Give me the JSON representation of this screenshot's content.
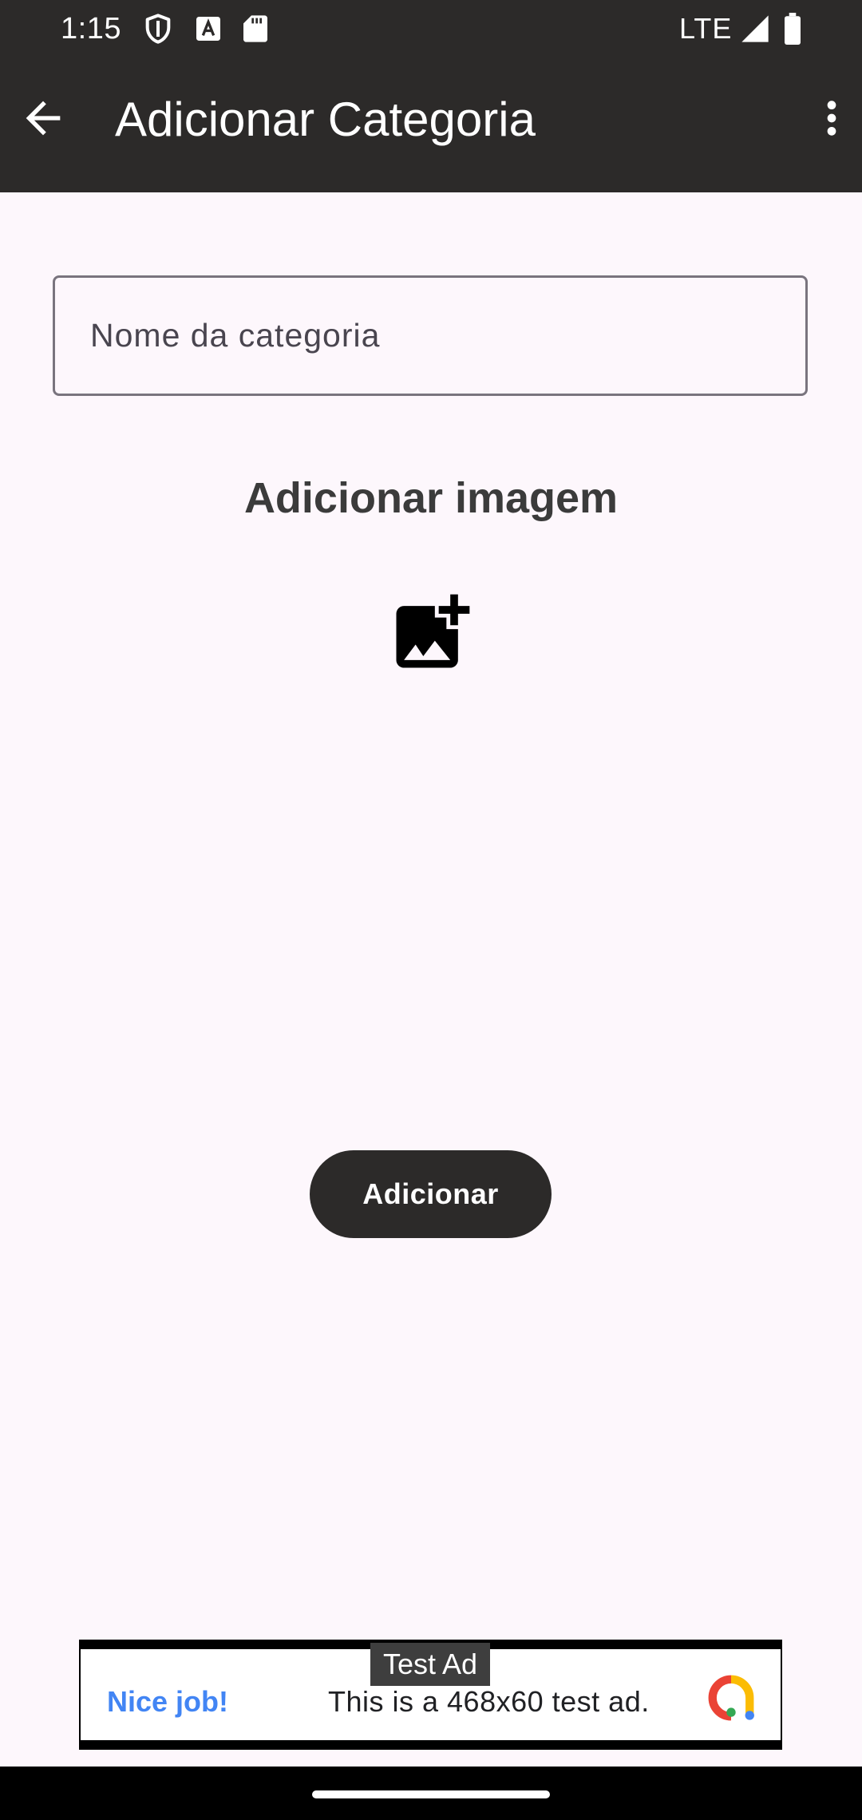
{
  "status_bar": {
    "time": "1:15",
    "network": "LTE",
    "icons": [
      "shield-icon",
      "font-app-icon",
      "sd-card-icon",
      "signal-icon",
      "battery-icon"
    ]
  },
  "app_bar": {
    "title": "Adicionar Categoria",
    "back_icon": "arrow-back-icon",
    "menu_icon": "more-vert-icon"
  },
  "form": {
    "name_placeholder": "Nome da categoria",
    "name_value": "",
    "image_section_title": "Adicionar imagem",
    "add_image_icon": "add-photo-icon",
    "submit_label": "Adicionar"
  },
  "ad": {
    "label": "Test Ad",
    "headline": "Nice job!",
    "body": "This is a 468x60 test ad.",
    "headline_color": "#4285f4"
  },
  "colors": {
    "app_bar": "#2c2a29",
    "background": "#fdf7fc",
    "button": "#2c2a29"
  }
}
